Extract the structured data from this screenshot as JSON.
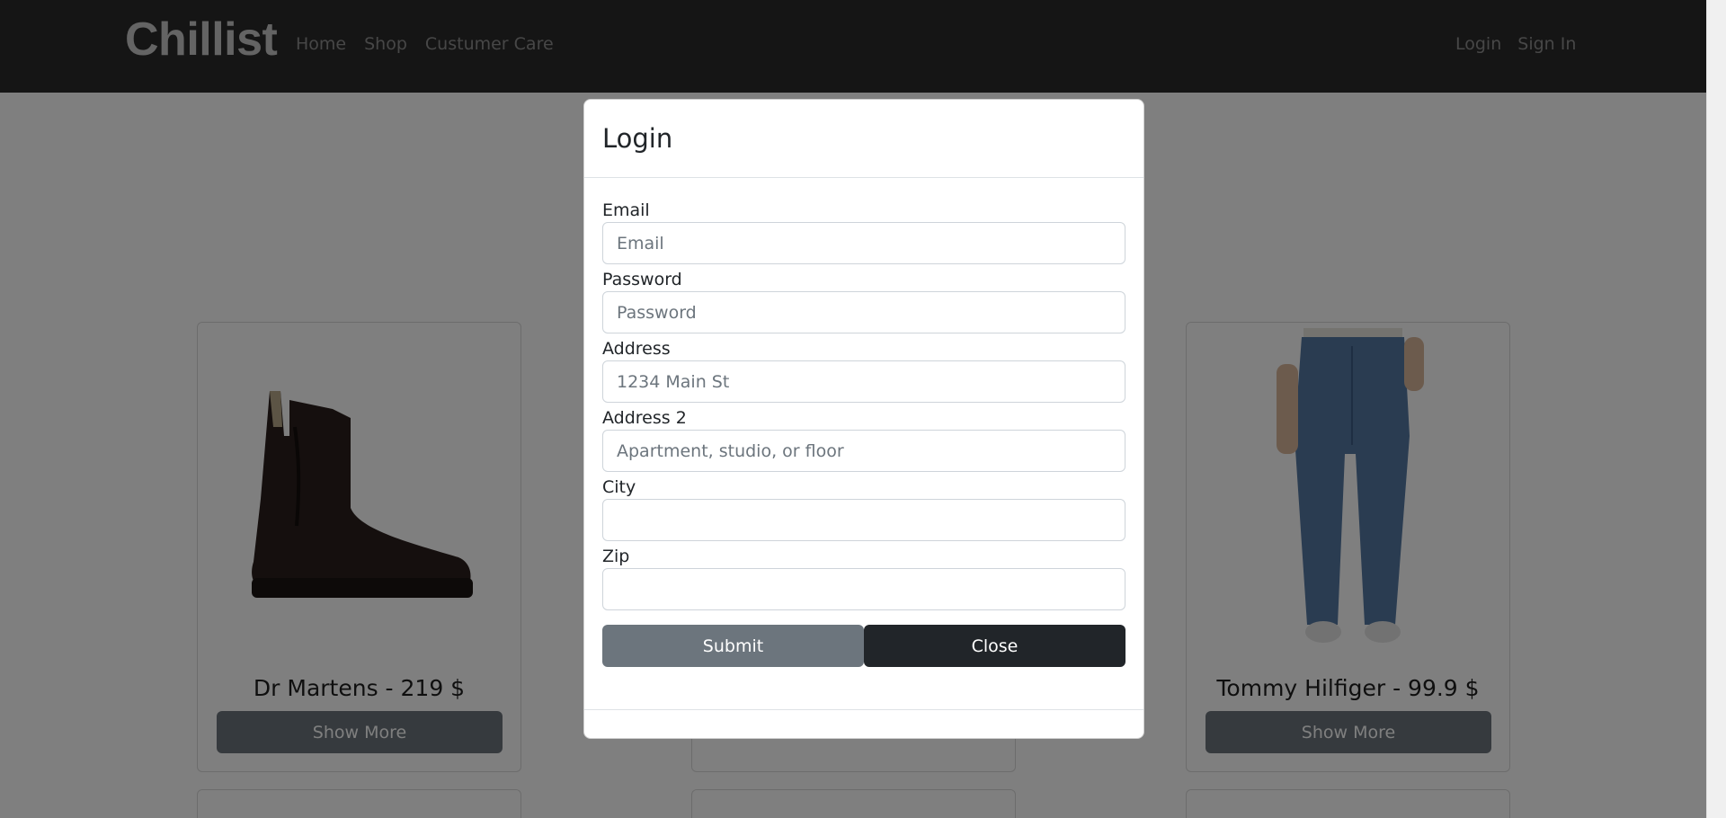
{
  "navbar": {
    "brand": "Chillist",
    "links": [
      "Home",
      "Shop",
      "Custumer Care"
    ],
    "right_links": [
      "Login",
      "Sign In"
    ]
  },
  "products": [
    {
      "title": "Dr Martens - 219 $",
      "button": "Show More",
      "image": "boot-image"
    },
    {
      "title": "",
      "button": "",
      "image": ""
    },
    {
      "title": "Tommy Hilfiger - 99.9 $",
      "button": "Show More",
      "image": "jeans-image"
    }
  ],
  "modal": {
    "title": "Login",
    "fields": [
      {
        "label": "Email",
        "placeholder": "Email",
        "value": ""
      },
      {
        "label": "Password",
        "placeholder": "Password",
        "value": ""
      },
      {
        "label": "Address",
        "placeholder": "1234 Main St",
        "value": ""
      },
      {
        "label": "Address 2",
        "placeholder": "Apartment, studio, or floor",
        "value": ""
      },
      {
        "label": "City",
        "placeholder": "",
        "value": ""
      },
      {
        "label": "Zip",
        "placeholder": "",
        "value": ""
      }
    ],
    "submit_label": "Submit",
    "close_label": "Close"
  },
  "colors": {
    "navbar_bg": "#2b2b2b",
    "submit_bg": "#6c757d",
    "close_bg": "#212529"
  }
}
